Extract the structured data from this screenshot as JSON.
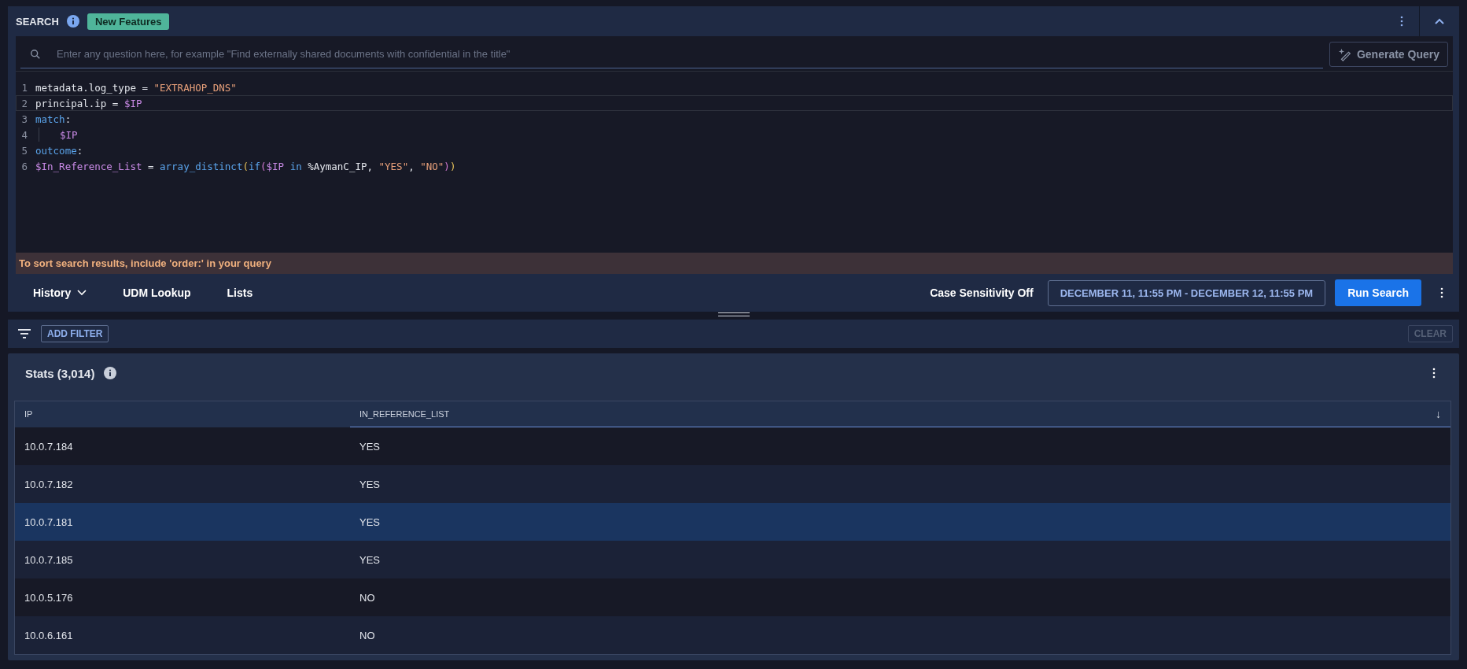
{
  "search_panel": {
    "title": "SEARCH",
    "badge": "New Features",
    "query_field": {
      "placeholder": "Enter any question here, for example \"Find externally shared documents with confidential in the title\""
    },
    "generate_button": "Generate Query",
    "code_lines": [
      {
        "number": "1",
        "active": false,
        "indented": false,
        "tokens": [
          {
            "kind": "plain",
            "text": "metadata.log_type = "
          },
          {
            "kind": "string",
            "text": "\"EXTRAHOP_DNS\""
          }
        ]
      },
      {
        "number": "2",
        "active": true,
        "indented": false,
        "tokens": [
          {
            "kind": "plain",
            "text": "principal.ip = "
          },
          {
            "kind": "variable",
            "text": "$IP"
          }
        ]
      },
      {
        "number": "3",
        "active": false,
        "indented": false,
        "tokens": [
          {
            "kind": "keyword",
            "text": "match"
          },
          {
            "kind": "plain",
            "text": ":"
          }
        ]
      },
      {
        "number": "4",
        "active": false,
        "indented": true,
        "tokens": [
          {
            "kind": "variable",
            "text": "$IP"
          }
        ]
      },
      {
        "number": "5",
        "active": false,
        "indented": false,
        "tokens": [
          {
            "kind": "keyword",
            "text": "outcome"
          },
          {
            "kind": "plain",
            "text": ":"
          }
        ]
      },
      {
        "number": "6",
        "active": false,
        "indented": false,
        "tokens": [
          {
            "kind": "variable",
            "text": "$In_Reference_List"
          },
          {
            "kind": "plain",
            "text": " = "
          },
          {
            "kind": "keyword",
            "text": "array_distinct"
          },
          {
            "kind": "paren",
            "text": "("
          },
          {
            "kind": "keyword",
            "text": "if"
          },
          {
            "kind": "paren2",
            "text": "("
          },
          {
            "kind": "variable",
            "text": "$IP"
          },
          {
            "kind": "keyword",
            "text": " in"
          },
          {
            "kind": "plain",
            "text": " %AymanC_IP, "
          },
          {
            "kind": "string",
            "text": "\"YES\""
          },
          {
            "kind": "plain",
            "text": ", "
          },
          {
            "kind": "string",
            "text": "\"NO\""
          },
          {
            "kind": "paren2",
            "text": ")"
          },
          {
            "kind": "paren",
            "text": ")"
          }
        ]
      }
    ],
    "hint": "To sort search results, include 'order:' in your query",
    "toolbar": {
      "links": [
        "History",
        "UDM Lookup",
        "Lists"
      ],
      "case_sensitivity": "Case Sensitivity Off",
      "time_range": "DECEMBER 11, 11:55 PM - DECEMBER 12, 11:55 PM",
      "run_button": "Run Search"
    }
  },
  "filter_bar": {
    "add_filter": "ADD FILTER",
    "clear": "CLEAR"
  },
  "stats": {
    "title": "Stats (3,014)",
    "columns": [
      {
        "label": "IP",
        "sorted": false
      },
      {
        "label": "IN_REFERENCE_LIST",
        "sorted": true
      }
    ],
    "sort_indicator": "↓",
    "rows": [
      {
        "ip": "10.0.7.184",
        "value": "YES",
        "selected": false
      },
      {
        "ip": "10.0.7.182",
        "value": "YES",
        "selected": false
      },
      {
        "ip": "10.0.7.181",
        "value": "YES",
        "selected": true
      },
      {
        "ip": "10.0.7.185",
        "value": "YES",
        "selected": false
      },
      {
        "ip": "10.0.5.176",
        "value": "NO",
        "selected": false
      },
      {
        "ip": "10.0.6.161",
        "value": "NO",
        "selected": false
      }
    ]
  }
}
